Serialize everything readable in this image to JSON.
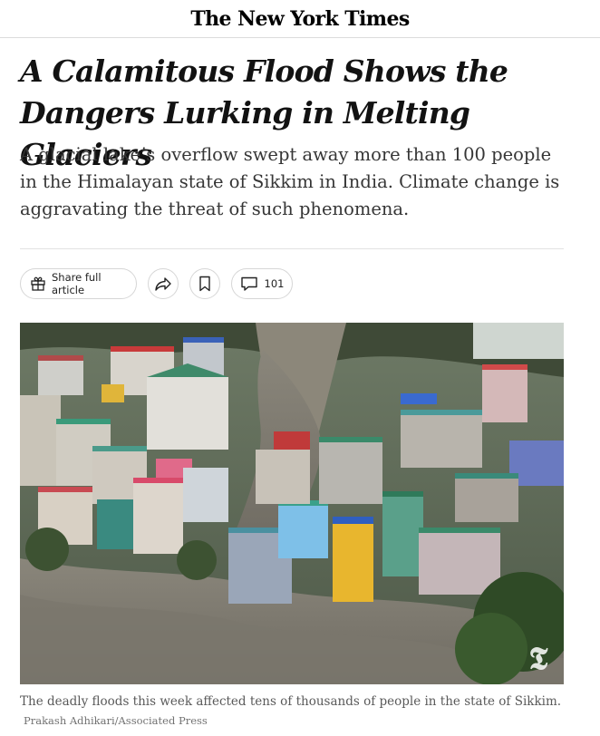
{
  "masthead": {
    "logo_text": "The New York Times"
  },
  "article": {
    "headline_line1": "A Calamitous Flood Shows the",
    "headline_line2": "Dangers Lurking in Melting Glaciers",
    "summary": "A glacial lake’s overflow swept away more than 100 people in the Himalayan state of Sikkim in India. Climate change is aggravating the threat of such phenomena."
  },
  "toolbar": {
    "share_full_label": "Share full article",
    "share_icon": "share-arrow-icon",
    "save_icon": "bookmark-icon",
    "comments_count": "101",
    "comments_icon": "comment-bubble-icon"
  },
  "photo": {
    "alt": "Aerial view of flooded town in Sikkim",
    "watermark": "𝕿"
  },
  "caption": {
    "text": "The deadly floods this week affected tens of thousands of people in the state of Sikkim.",
    "credit": "Prakash Adhikari/Associated Press"
  },
  "colors": {
    "text": "#121212",
    "summary": "#363636",
    "caption": "#5a5a5a",
    "divider": "#e2e2e2"
  }
}
